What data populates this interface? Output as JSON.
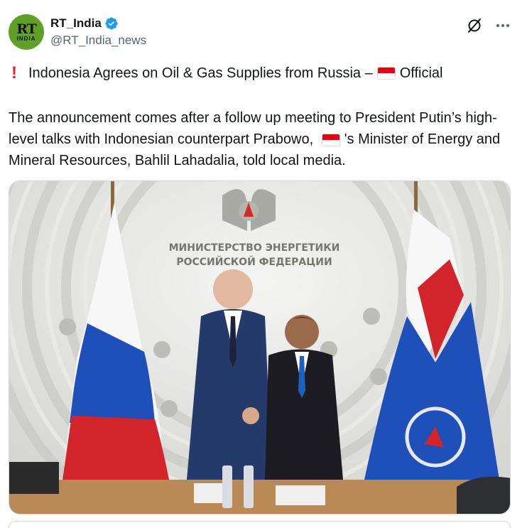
{
  "account": {
    "display_name": "RT_India",
    "handle": "@RT_India_news",
    "avatar_text": "RT",
    "avatar_subtext": "INDIA",
    "verified": true
  },
  "tweet": {
    "headline_prefix": "Indonesia Agrees on Oil & Gas Supplies from Russia –",
    "headline_suffix": "Official",
    "body_part1": "The announcement comes after a follow up meeting to President Putin’s high-level talks with Indonesian counterpart Prabowo,",
    "body_part2": "'s Minister of Energy and Mineral Resources, Bahlil Lahadalia, told local media."
  },
  "media": {
    "wall_text_line1": "МИНИСТЕРСТВО ЭНЕРГЕТИКИ",
    "wall_text_line2": "РОССИЙСКОЙ ФЕДЕРАЦИИ"
  },
  "icons": {
    "verified": "verified-badge-icon",
    "grok": "grok-icon",
    "more": "more-options-icon",
    "alert": "red-exclamation-icon",
    "flag": "indonesia-flag-icon"
  },
  "colors": {
    "verified": "#1d9bf0",
    "avatar_bg": "#5fa126",
    "alert": "#e3221c",
    "handle": "#536471"
  }
}
